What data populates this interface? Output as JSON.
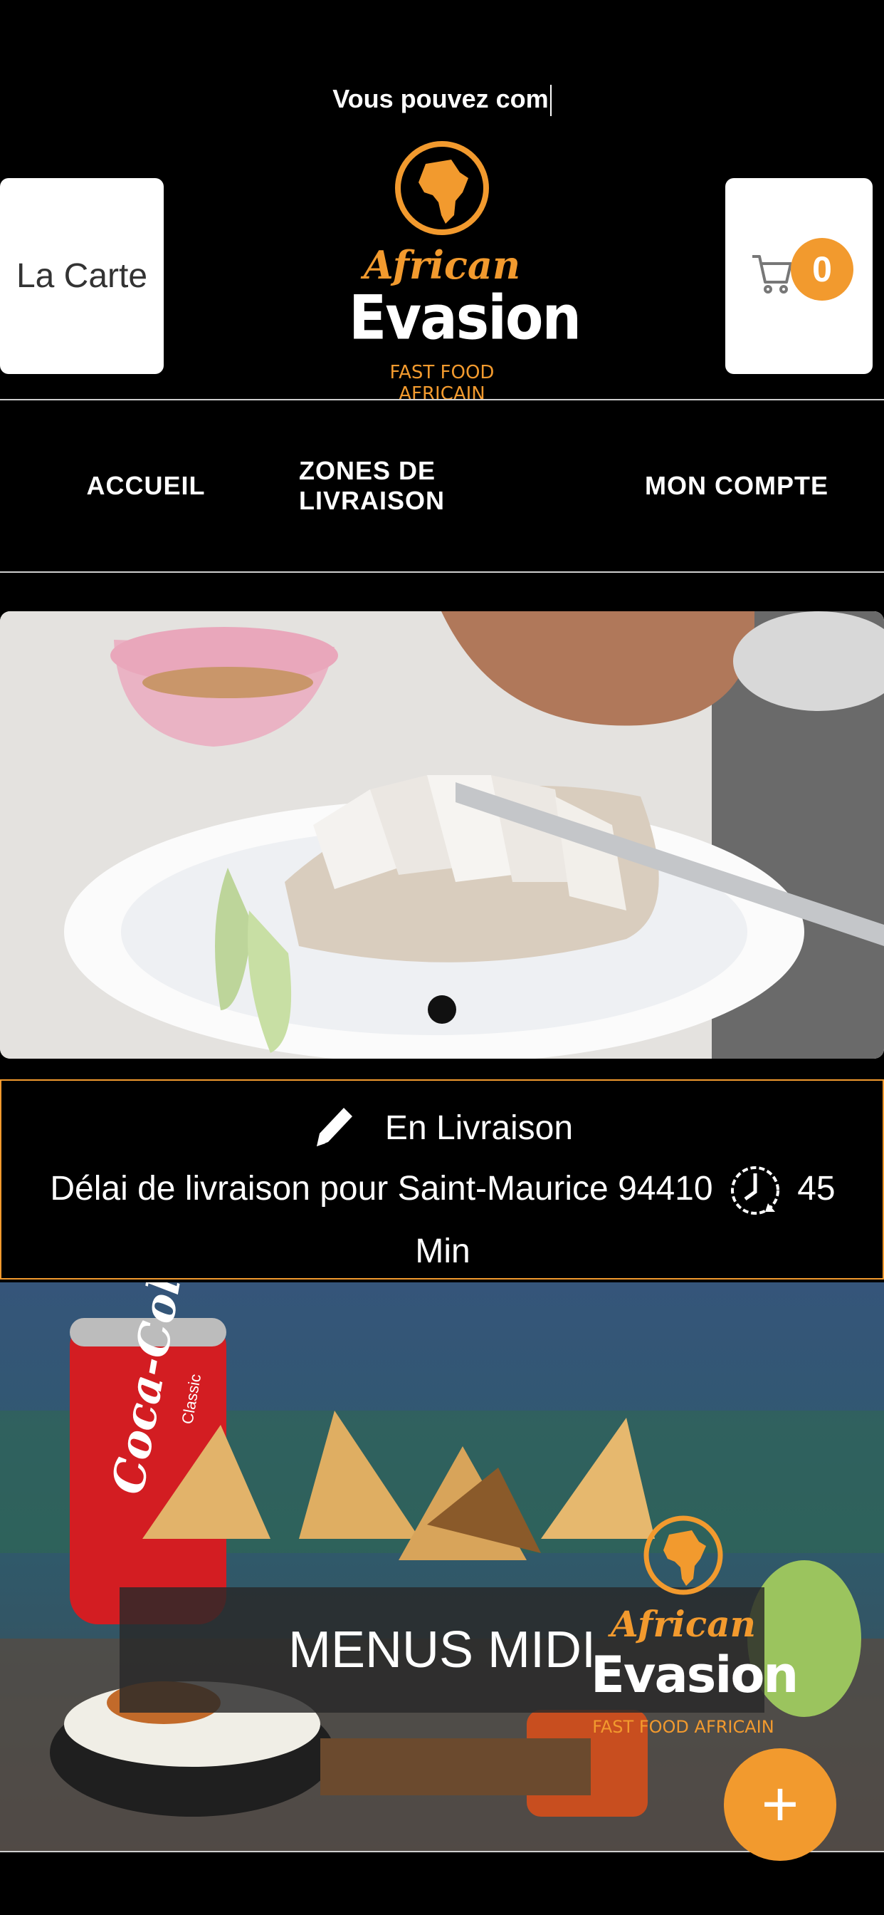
{
  "header": {
    "ticker_text": "Vous pouvez com",
    "menu_button_label": "La Carte",
    "cart_count": "0",
    "logo": {
      "line1": "African",
      "line2": "Evasion",
      "line3": "FAST FOOD AFRICAIN"
    }
  },
  "nav": {
    "items": [
      {
        "label": "ACCUEIL"
      },
      {
        "label": "ZONES DE LIVRAISON"
      },
      {
        "label": "MON COMPTE"
      }
    ]
  },
  "delivery": {
    "mode_label": "En Livraison",
    "delay_text": "Délai de livraison pour Saint-Maurice 94410",
    "delay_value": "45",
    "delay_unit": "Min"
  },
  "promo": {
    "label": "MENUS MIDI",
    "can_text": "Coca-Cola",
    "can_subtext": "Classic",
    "logo": {
      "line1": "African",
      "line2": "Evasion",
      "line3": "FAST FOOD AFRICAIN"
    }
  },
  "fab": {
    "icon": "plus-icon",
    "symbol": "+"
  },
  "colors": {
    "accent": "#f29a2e",
    "background": "#000000",
    "button_bg": "#ffffff"
  }
}
